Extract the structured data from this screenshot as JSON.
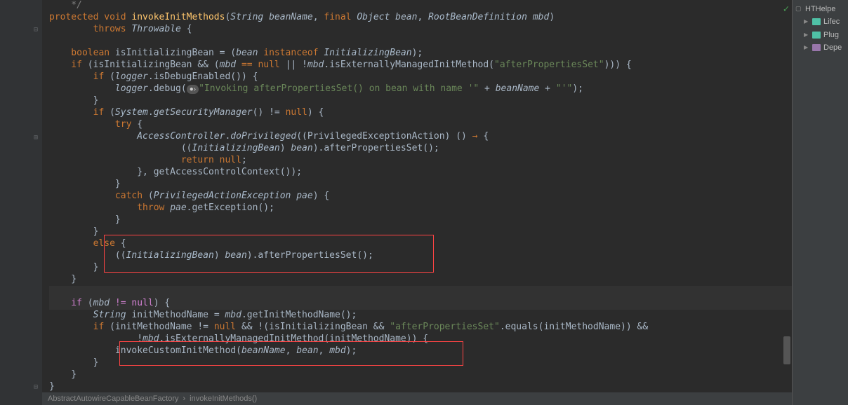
{
  "code": {
    "comment_end": "    */",
    "sig1": "protected void ",
    "method_name": "invokeInitMethods",
    "sig2": "(",
    "p1t": "String ",
    "p1n": "beanName",
    "sig3": ", ",
    "p2k": "final ",
    "p2t": "Object ",
    "p2n": "bean",
    "sig4": ", ",
    "p3t": "RootBeanDefinition ",
    "p3n": "mbd",
    "sig5": ")",
    "throws": "        throws ",
    "throwable": "Throwable",
    "throws2": " {",
    "l1a": "    boolean ",
    "l1b": "isInitializingBean = (",
    "l1c": "bean",
    "l1d": " instanceof ",
    "l1e": "InitializingBean",
    "l1f": ");",
    "l2a": "    if ",
    "l2b": "(isInitializingBean && (",
    "l2c": "mbd",
    "l2d": " == ",
    "l2e": "null",
    "l2f": " || !",
    "l2g": "mbd",
    "l2h": ".isExternallyManagedInitMethod(",
    "l2i": "\"afterPropertiesSet\"",
    "l2j": "))) {",
    "l3a": "        if ",
    "l3b": "(",
    "l3c": "logger",
    "l3d": ".isDebugEnabled()) {",
    "l4a": "            ",
    "l4b": "logger",
    "l4c": ".debug(",
    "l4d": "\"Invoking afterPropertiesSet() on bean with name '\"",
    "l4e": " + ",
    "l4f": "beanName",
    "l4g": " + ",
    "l4h": "\"'\"",
    "l4i": ");",
    "l5": "        }",
    "l6a": "        if ",
    "l6b": "(",
    "l6c": "System",
    "l6d": ".",
    "l6e": "getSecurityManager",
    "l6f": "() != ",
    "l6g": "null",
    "l6h": ") {",
    "l7a": "            try ",
    "l7b": "{",
    "l8a": "                ",
    "l8b": "AccessController",
    "l8c": ".",
    "l8d": "doPrivileged",
    "l8e": "((PrivilegedExceptionAction) () ",
    "l8f": "→",
    "l8g": " {",
    "l9a": "                        ((",
    "l9b": "InitializingBean",
    "l9c": ") ",
    "l9d": "bean",
    "l9e": ").afterPropertiesSet();",
    "l10a": "                        return null;",
    "l10r": "return null",
    "l11a": "                }, getAccessControlContext());",
    "l12": "            }",
    "l13a": "            catch ",
    "l13b": "(",
    "l13c": "PrivilegedActionException ",
    "l13d": "pae",
    "l13e": ") {",
    "l14a": "                throw ",
    "l14b": "pae",
    "l14c": ".getException();",
    "l15": "            }",
    "l16": "        }",
    "l17a": "        else ",
    "l17b": "{",
    "l18a": "            ((",
    "l18b": "InitializingBean",
    "l18c": ") ",
    "l18d": "bean",
    "l18e": ").afterPropertiesSet();",
    "l19": "        }",
    "l20": "    }",
    "l21a": "    if ",
    "l21b": "(",
    "l21c": "mbd",
    "l21d": " != ",
    "l21e": "null",
    "l21f": ") {",
    "l22a": "        ",
    "l22b": "String ",
    "l22c": "initMethodName = ",
    "l22d": "mbd",
    "l22e": ".getInitMethodName();",
    "l23a": "        if ",
    "l23b": "(initMethodName != ",
    "l23c": "null",
    "l23d": " && !(isInitializingBean && ",
    "l23e": "\"afterPropertiesSet\"",
    "l23f": ".equals(initMethodName)) &&",
    "l24a": "                !",
    "l24b": "mbd",
    "l24c": ".isExternallyManagedInitMethod(initMethodName)) {",
    "l25a": "            invokeCustomInitMethod(",
    "l25b": "beanName",
    "l25c": ", ",
    "l25d": "bean",
    "l25e": ", ",
    "l25f": "mbd",
    "l25g": ");",
    "l26": "        }",
    "l27": "    }",
    "l28": "}"
  },
  "breadcrumb": {
    "item1": "AbstractAutowireCapableBeanFactory",
    "sep": "›",
    "item2": "invokeInitMethods()"
  },
  "sidebar": {
    "header": "HTHelpe",
    "items": [
      "Lifec",
      "Plug",
      "Depe"
    ]
  }
}
